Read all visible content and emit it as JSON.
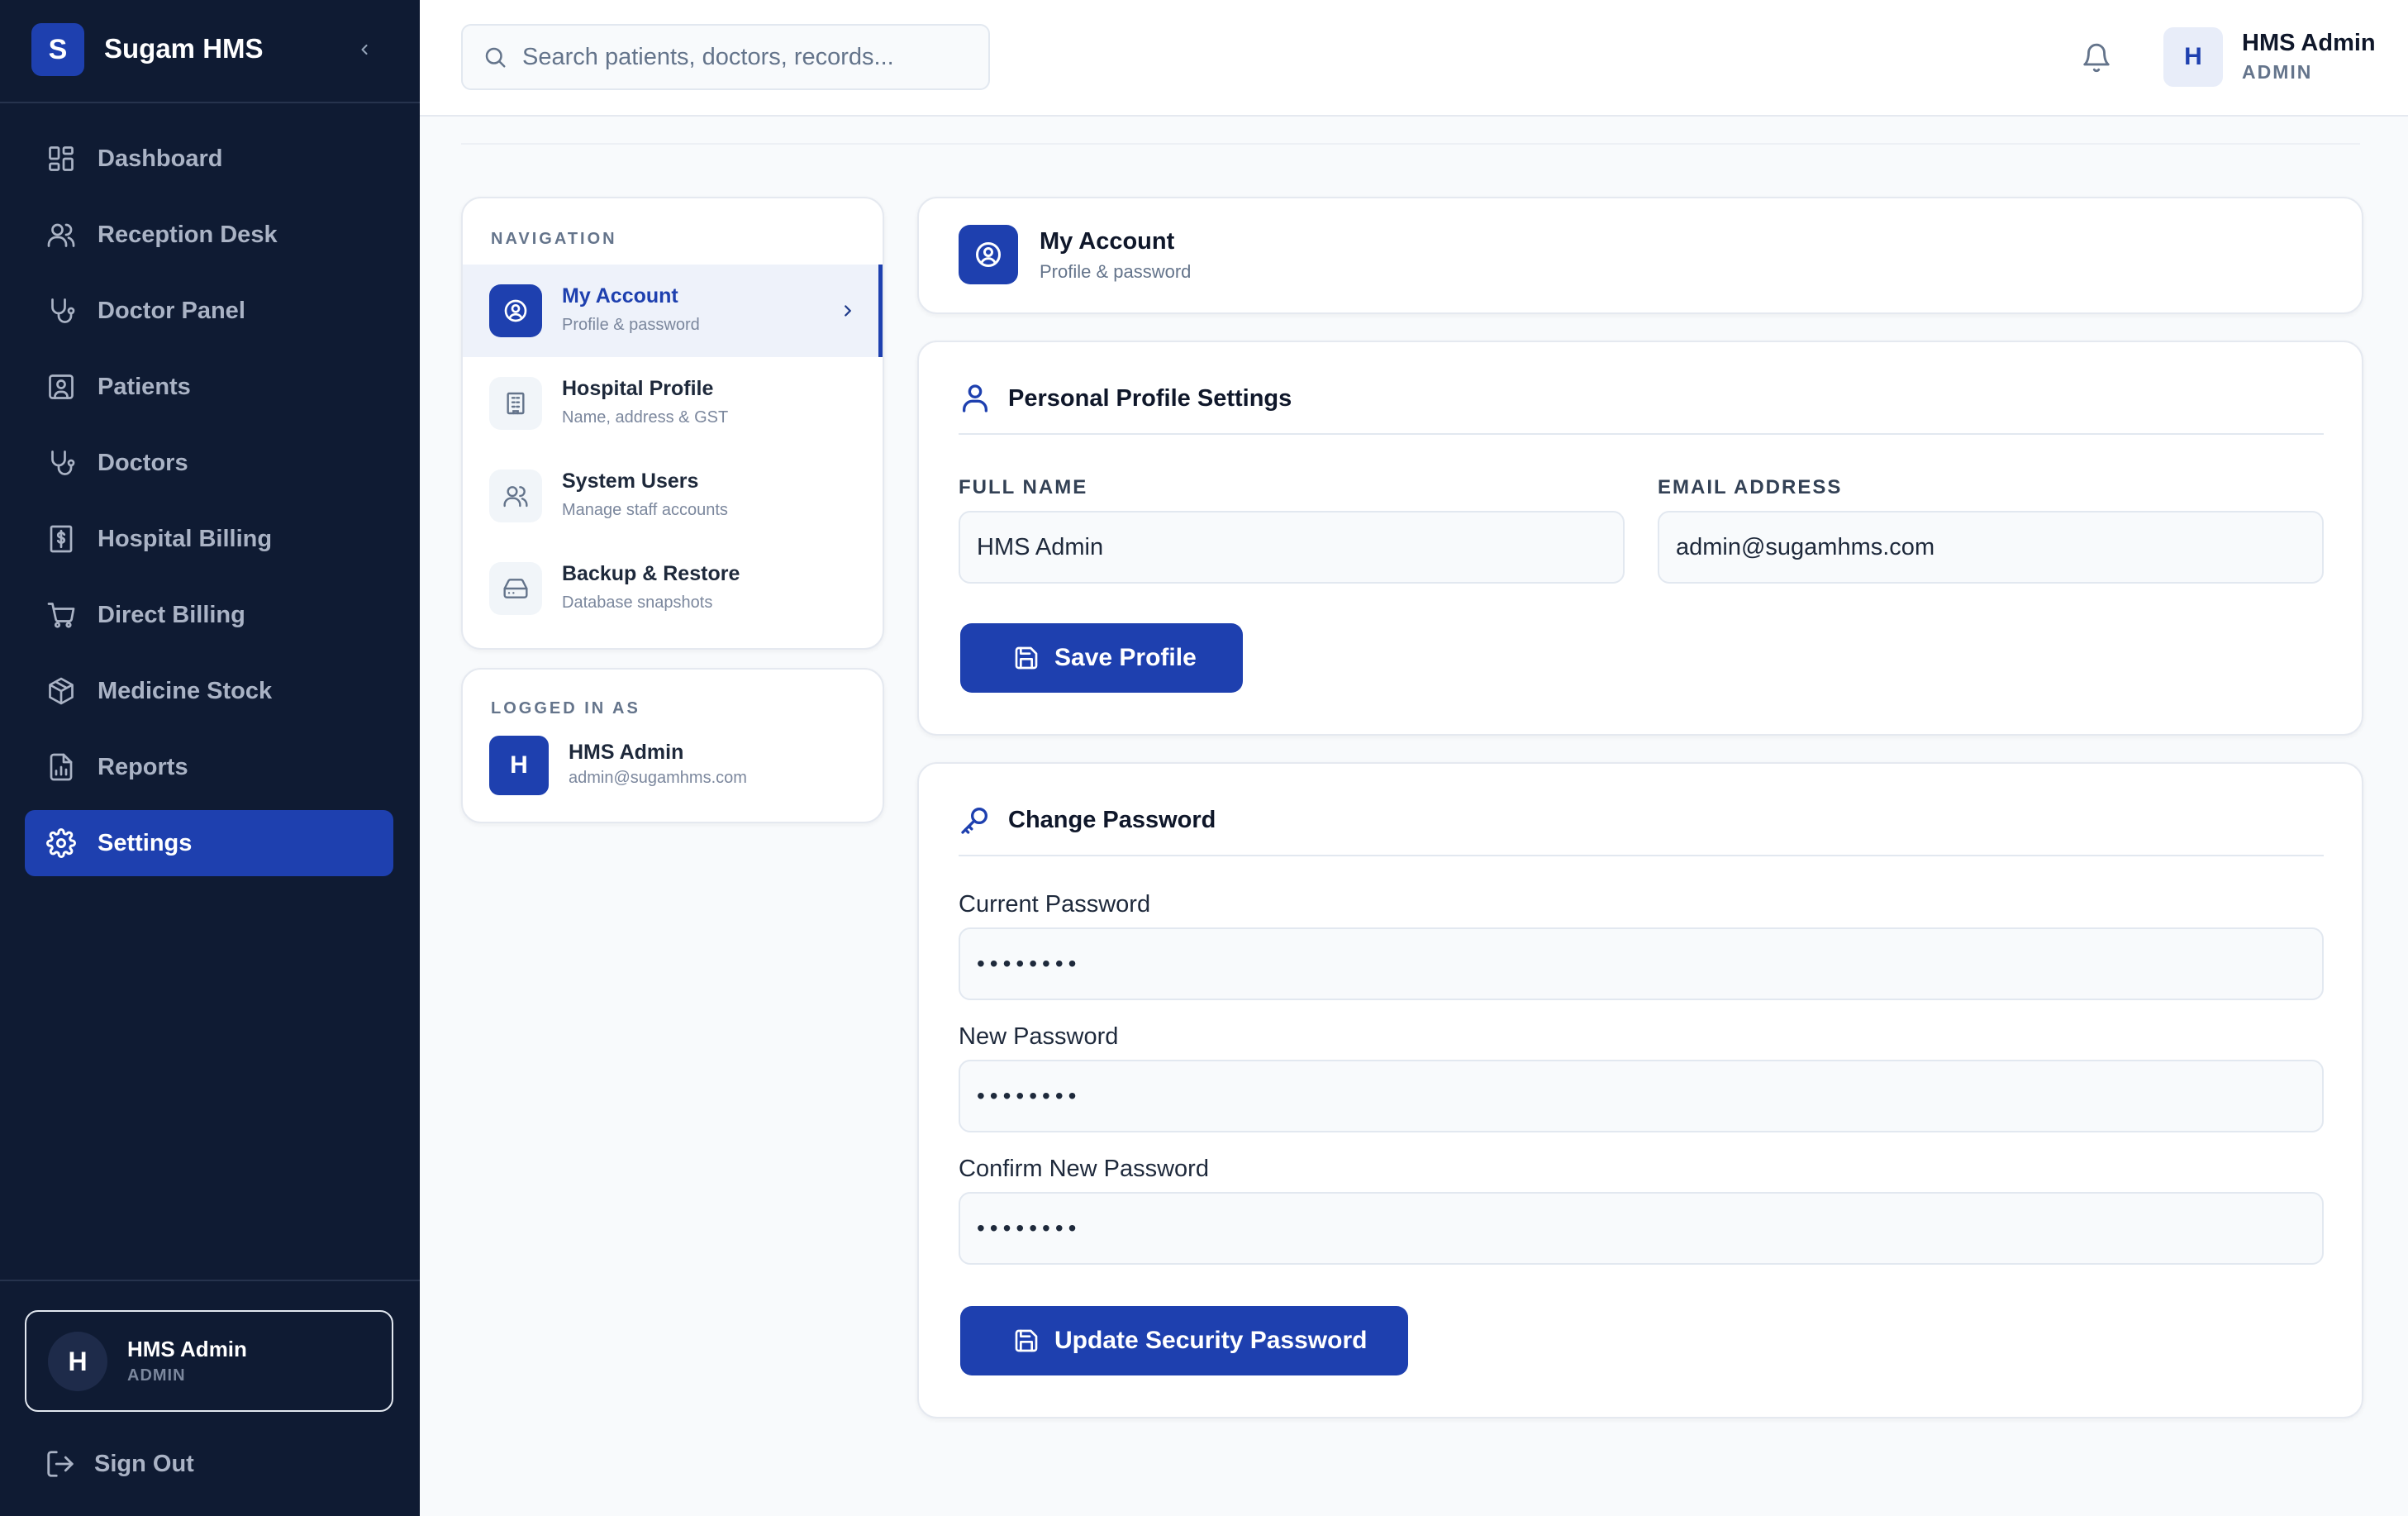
{
  "app": {
    "logo_letter": "S",
    "name": "Sugam HMS"
  },
  "sidebar": {
    "items": [
      {
        "label": "Dashboard",
        "icon": "dashboard-icon"
      },
      {
        "label": "Reception Desk",
        "icon": "users-icon"
      },
      {
        "label": "Doctor Panel",
        "icon": "stethoscope-icon"
      },
      {
        "label": "Patients",
        "icon": "patient-icon"
      },
      {
        "label": "Doctors",
        "icon": "stethoscope-icon"
      },
      {
        "label": "Hospital Billing",
        "icon": "receipt-icon"
      },
      {
        "label": "Direct Billing",
        "icon": "cart-icon"
      },
      {
        "label": "Medicine Stock",
        "icon": "package-icon"
      },
      {
        "label": "Reports",
        "icon": "report-icon"
      },
      {
        "label": "Settings",
        "icon": "gear-icon",
        "active": true
      }
    ],
    "user": {
      "avatar": "H",
      "name": "HMS Admin",
      "role": "ADMIN"
    },
    "sign_out": "Sign Out"
  },
  "topbar": {
    "search_placeholder": "Search patients, doctors, records...",
    "user": {
      "avatar": "H",
      "name": "HMS Admin",
      "role": "ADMIN"
    }
  },
  "settings_nav": {
    "section_label": "NAVIGATION",
    "items": [
      {
        "title": "My Account",
        "subtitle": "Profile & password",
        "icon": "user-circle-icon",
        "active": true
      },
      {
        "title": "Hospital Profile",
        "subtitle": "Name, address & GST",
        "icon": "building-icon"
      },
      {
        "title": "System Users",
        "subtitle": "Manage staff accounts",
        "icon": "users-icon"
      },
      {
        "title": "Backup & Restore",
        "subtitle": "Database snapshots",
        "icon": "hard-drive-icon"
      }
    ],
    "logged_in": {
      "label": "LOGGED IN AS",
      "avatar": "H",
      "name": "HMS Admin",
      "email": "admin@sugamhms.com"
    }
  },
  "header": {
    "title": "My Account",
    "subtitle": "Profile & password"
  },
  "profile": {
    "title": "Personal Profile Settings",
    "full_name_label": "FULL NAME",
    "full_name_value": "HMS Admin",
    "email_label": "EMAIL ADDRESS",
    "email_value": "admin@sugamhms.com",
    "save_button": "Save Profile"
  },
  "password": {
    "title": "Change Password",
    "current_label": "Current Password",
    "current_value": "••••••••",
    "new_label": "New Password",
    "new_value": "••••••••",
    "confirm_label": "Confirm New Password",
    "confirm_value": "••••••••",
    "update_button": "Update Security Password"
  },
  "colors": {
    "primary": "#1e40af",
    "sidebar_bg": "#0f1b33",
    "page_bg": "#f8fafc"
  }
}
